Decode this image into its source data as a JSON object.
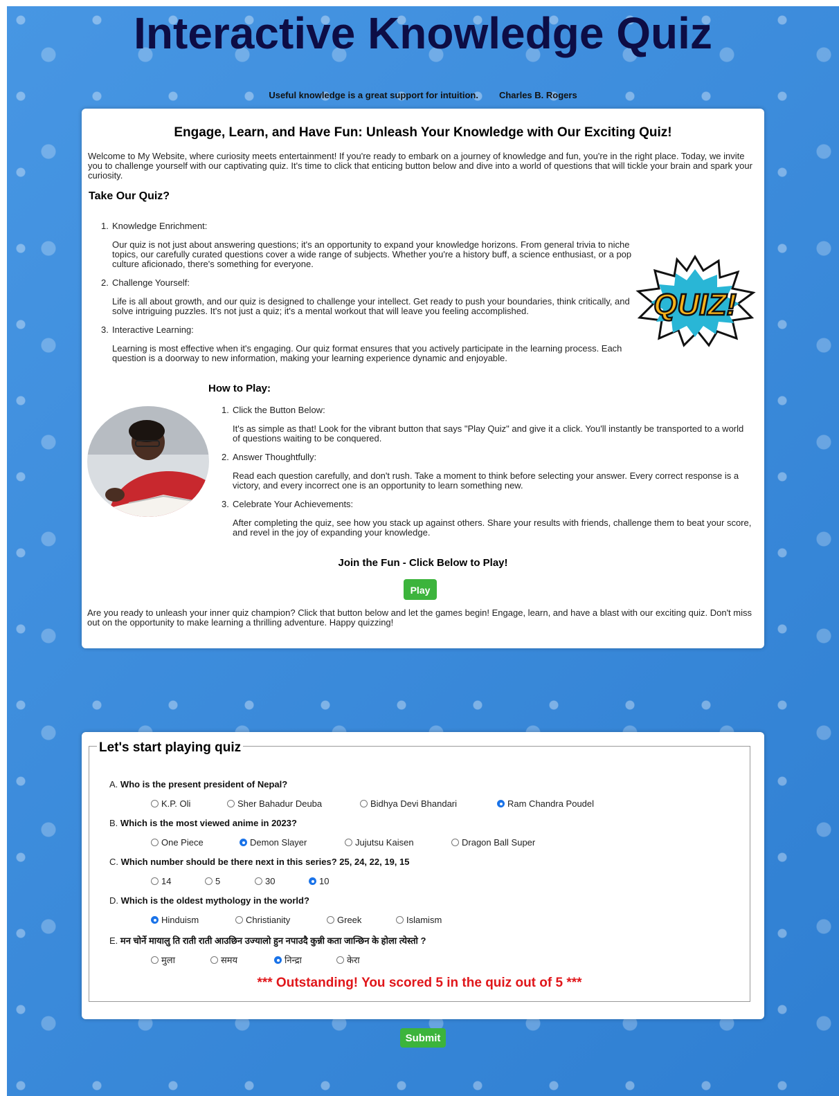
{
  "header": {
    "title": "Interactive Knowledge Quiz",
    "quote": "Useful knowledge is a great support for intuition.",
    "quote_author": "Charles B. Rogers"
  },
  "intro_card": {
    "heading": "Engage, Learn, and Have Fun: Unleash Your Knowledge with Our Exciting Quiz!",
    "intro": "Welcome to My Website, where curiosity meets entertainment! If you're ready to embark on a journey of knowledge and fun, you're in the right place. Today, we invite you to challenge yourself with our captivating quiz. It's time to click that enticing button below and dive into a world of questions that will tickle your brain and spark your curiosity.",
    "take_heading": "Take Our Quiz?",
    "take_items": [
      {
        "num": "1.",
        "label": "Knowledge Enrichment:",
        "text": "Our quiz is not just about answering questions; it's an opportunity to expand your knowledge horizons. From general trivia to niche topics, our carefully curated questions cover a wide range of subjects. Whether you're a history buff, a science enthusiast, or a pop culture aficionado, there's something for everyone."
      },
      {
        "num": "2.",
        "label": "Challenge Yourself:",
        "text": "Life is all about growth, and our quiz is designed to challenge your intellect. Get ready to push your boundaries, think critically, and solve intriguing puzzles. It's not just a quiz; it's a mental workout that will leave you feeling accomplished."
      },
      {
        "num": "3.",
        "label": "Interactive Learning:",
        "text": "Learning is most effective when it's engaging. Our quiz format ensures that you actively participate in the learning process. Each question is a doorway to new information, making your learning experience dynamic and enjoyable."
      }
    ],
    "quiz_logo_text": "QUIZ!",
    "how_heading": "How to Play:",
    "how_items": [
      {
        "num": "1.",
        "label": "Click the Button Below:",
        "text": "It's as simple as that! Look for the vibrant button that says \"Play Quiz\" and give it a click. You'll instantly be transported to a world of questions waiting to be conquered."
      },
      {
        "num": "2.",
        "label": "Answer Thoughtfully:",
        "text": "Read each question carefully, and don't rush. Take a moment to think before selecting your answer. Every correct response is a victory, and every incorrect one is an opportunity to learn something new."
      },
      {
        "num": "3.",
        "label": "Celebrate Your Achievements:",
        "text": "After completing the quiz, see how you stack up against others. Share your results with friends, challenge them to beat your score, and revel in the joy of expanding your knowledge."
      }
    ],
    "join_heading": "Join the Fun - Click Below to Play!",
    "play_label": "Play",
    "outro": "Are you ready to unleash your inner quiz champion? Click that button below and let the games begin! Engage, learn, and have a blast with our exciting quiz. Don't miss out on the opportunity to make learning a thrilling adventure. Happy quizzing!"
  },
  "quiz": {
    "legend": "Let's start playing quiz",
    "questions": [
      {
        "letter": "A.",
        "text": "Who is the present president of Nepal?",
        "options": [
          "K.P. Oli",
          "Sher Bahadur Deuba",
          "Bidhya Devi Bhandari",
          "Ram Chandra Poudel"
        ],
        "selected": 3
      },
      {
        "letter": "B.",
        "text": "Which is the most viewed anime in 2023?",
        "options": [
          "One Piece",
          "Demon Slayer",
          "Jujutsu Kaisen",
          "Dragon Ball Super"
        ],
        "selected": 1
      },
      {
        "letter": "C.",
        "text": "Which number should be there next in this series? 25, 24, 22, 19, 15",
        "options": [
          "14",
          "5",
          "30",
          "10"
        ],
        "selected": 3
      },
      {
        "letter": "D.",
        "text": "Which is the oldest mythology in the world?",
        "options": [
          "Hinduism",
          "Christianity",
          "Greek",
          "Islamism"
        ],
        "selected": 0
      },
      {
        "letter": "E.",
        "text": "मन चोर्ने मायालु ति राती राती आउछिन उज्यालो हुन नपाउदै कुन्नी कता जान्छिन के होला त्येस्तो ?",
        "options": [
          "मुला",
          "समय",
          "निन्द्रा",
          "केरा"
        ],
        "selected": 2
      }
    ],
    "result": "*** Outstanding! You scored 5 in the quiz out of 5 ***",
    "submit_label": "Submit"
  },
  "colors": {
    "background": "#3d8fdf",
    "title": "#0d0d45",
    "button": "#3cb43c",
    "result": "#e0161a",
    "radio_selected": "#1a73e8"
  }
}
